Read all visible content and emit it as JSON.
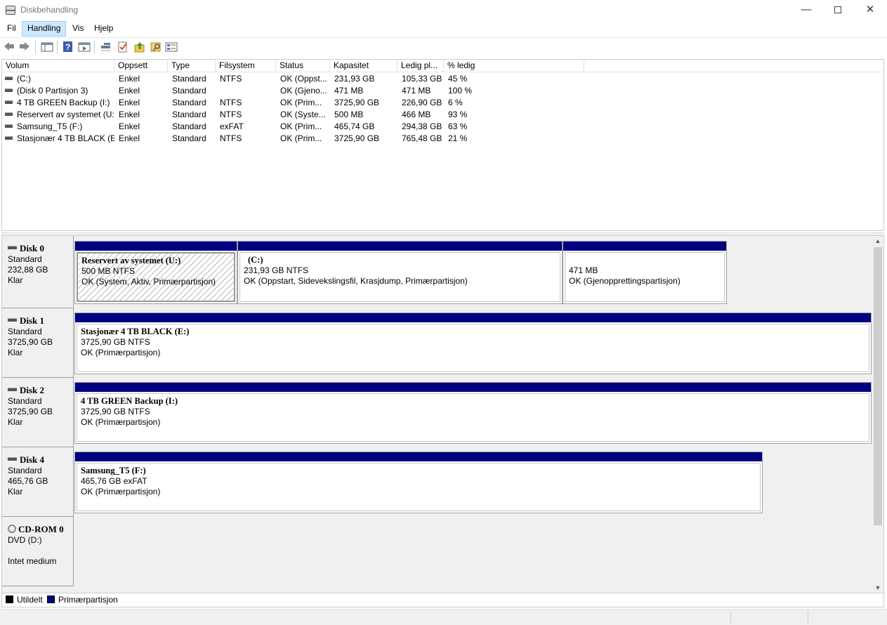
{
  "window": {
    "title": "Diskbehandling",
    "minimize": "—",
    "close": "✕"
  },
  "menu": [
    "Fil",
    "Handling",
    "Vis",
    "Hjelp"
  ],
  "toolbar": [
    "back-icon",
    "forward-icon",
    "show-pane-icon",
    "help-icon",
    "action-pane-icon",
    "connect-icon",
    "properties-icon",
    "export-icon",
    "search-icon",
    "list-view-icon"
  ],
  "volumes": {
    "columns": [
      "Volum",
      "Oppsett",
      "Type",
      "Filsystem",
      "Status",
      "Kapasitet",
      "Ledig pl...",
      "% ledig"
    ],
    "rows": [
      [
        "(C:)",
        "Enkel",
        "Standard",
        "NTFS",
        "OK (Oppst...",
        "231,93 GB",
        "105,33 GB",
        "45 %"
      ],
      [
        "(Disk 0 Partisjon 3)",
        "Enkel",
        "Standard",
        "",
        "OK (Gjeno...",
        "471 MB",
        "471 MB",
        "100 %"
      ],
      [
        "4 TB GREEN Backup (I:)",
        "Enkel",
        "Standard",
        "NTFS",
        "OK (Prim...",
        "3725,90 GB",
        "226,90 GB",
        "6 %"
      ],
      [
        "Reservert av systemet (U:)",
        "Enkel",
        "Standard",
        "NTFS",
        "OK (Syste...",
        "500 MB",
        "466 MB",
        "93 %"
      ],
      [
        "Samsung_T5 (F:)",
        "Enkel",
        "Standard",
        "exFAT",
        "OK (Prim...",
        "465,74 GB",
        "294,38 GB",
        "63 %"
      ],
      [
        "Stasjonær 4 TB BLACK (E:)",
        "Enkel",
        "Standard",
        "NTFS",
        "OK (Prim...",
        "3725,90 GB",
        "765,48 GB",
        "21 %"
      ]
    ]
  },
  "disks": [
    {
      "name": "Disk 0",
      "type": "Standard",
      "size": "232,88 GB",
      "state": "Klar",
      "partitions": [
        {
          "title": "Reservert av systemet  (U:)",
          "size": "500 MB NTFS",
          "status": "OK (System, Aktiv, Primærpartisjon)"
        },
        {
          "title": "(C:)",
          "size": "231,93 GB NTFS",
          "status": "OK (Oppstart, Sidevekslingsfil, Krasjdump, Primærpartisjon)"
        },
        {
          "title": "",
          "size": "471 MB",
          "status": "OK (Gjenopprettingspartisjon)"
        }
      ]
    },
    {
      "name": "Disk 1",
      "type": "Standard",
      "size": "3725,90 GB",
      "state": "Klar",
      "partitions": [
        {
          "title": "Stasjonær 4 TB BLACK  (E:)",
          "size": "3725,90 GB NTFS",
          "status": "OK (Primærpartisjon)"
        }
      ]
    },
    {
      "name": "Disk 2",
      "type": "Standard",
      "size": "3725,90 GB",
      "state": "Klar",
      "partitions": [
        {
          "title": "4 TB GREEN Backup  (I:)",
          "size": "3725,90 GB NTFS",
          "status": "OK (Primærpartisjon)"
        }
      ]
    },
    {
      "name": "Disk 4",
      "type": "Standard",
      "size": "465,76 GB",
      "state": "Klar",
      "partitions": [
        {
          "title": "Samsung_T5  (F:)",
          "size": "465,76 GB exFAT",
          "status": "OK (Primærpartisjon)"
        }
      ]
    }
  ],
  "cdrom": {
    "name": "CD-ROM 0",
    "drive": "DVD (D:)",
    "state": "Intet medium"
  },
  "legend": {
    "unallocated": "Utildelt",
    "primary": "Primærpartisjon",
    "unallocated_color": "#000000",
    "primary_color": "#000080"
  }
}
